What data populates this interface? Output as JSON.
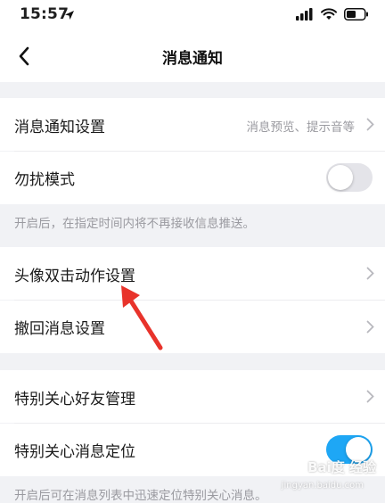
{
  "status_bar": {
    "time": "15:57"
  },
  "nav": {
    "title": "消息通知"
  },
  "rows": {
    "notification_settings": {
      "label": "消息通知设置",
      "sub": "消息预览、提示音等"
    },
    "dnd": {
      "label": "勿扰模式",
      "toggle": false
    },
    "dnd_hint": "开启后，在指定时间内将不再接收信息推送。",
    "avatar_double_tap": {
      "label": "头像双击动作设置"
    },
    "recall": {
      "label": "撤回消息设置"
    },
    "special_care_friends": {
      "label": "特别关心好友管理"
    },
    "special_care_locate": {
      "label": "特别关心消息定位",
      "toggle": true
    },
    "special_care_hint": "开启后可在消息列表中迅速定位特别关心消息。"
  },
  "watermark": {
    "text": "Bai度 经验",
    "sub": "jingyan.baidu.com"
  },
  "colors": {
    "accent": "#1ea7f5",
    "annotation": "#e8332b"
  }
}
